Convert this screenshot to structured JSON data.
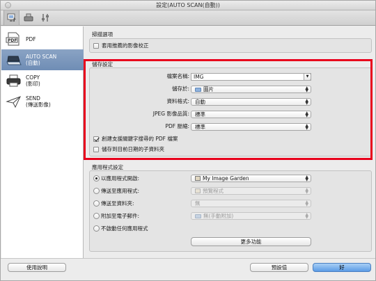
{
  "window": {
    "title": "設定(AUTO SCAN(自動))"
  },
  "toolbar": {
    "tabs": [
      {
        "name": "scan-from-computer-tab",
        "icon": "computer-scan-icon"
      },
      {
        "name": "scan-from-operation-panel-tab",
        "icon": "scanner-icon"
      },
      {
        "name": "general-settings-tab",
        "icon": "sliders-icon"
      }
    ]
  },
  "sidebar": {
    "items": [
      {
        "label": "PDF",
        "sublabel": "",
        "icon": "pdf-document-icon"
      },
      {
        "label": "AUTO SCAN",
        "sublabel": "(自動)",
        "icon": "auto-scan-icon",
        "selected": true
      },
      {
        "label": "COPY",
        "sublabel": "(影印)",
        "icon": "printer-icon"
      },
      {
        "label": "SEND",
        "sublabel": "(傳送影像)",
        "icon": "paper-plane-icon"
      }
    ]
  },
  "scan_options": {
    "title": "掃描選項",
    "apply_correction_label": "套用推薦的影像校正",
    "apply_correction_checked": false
  },
  "save_settings": {
    "title": "儲存設定",
    "file_name_label": "檔案名稱:",
    "file_name_value": "IMG",
    "save_in_label": "儲存於:",
    "save_in_value": "圖片",
    "data_format_label": "資料格式:",
    "data_format_value": "自動",
    "jpeg_quality_label": "JPEG 影像品質:",
    "jpeg_quality_value": "標準",
    "pdf_compression_label": "PDF 壓縮:",
    "pdf_compression_value": "標準",
    "create_pdf_keyword_label": "創建支援關鍵字搜尋的 PDF 檔案",
    "create_pdf_keyword_checked": true,
    "save_subfolder_label": "儲存到目前日期的子資料夾",
    "save_subfolder_checked": false
  },
  "app_settings": {
    "title": "應用程式設定",
    "open_app_label": "以應用程式開啟:",
    "open_app_value": "My Image Garden",
    "send_app_label": "傳送至應用程式:",
    "send_app_value": "預覽程式",
    "send_folder_label": "傳送至資料夾:",
    "send_folder_value": "無",
    "email_label": "附加至電子郵件:",
    "email_value": "無(手動附加)",
    "no_app_label": "不啟動任何應用程式",
    "more_functions_label": "更多功能",
    "selected": "open_app"
  },
  "footer": {
    "help_label": "使用說明",
    "defaults_label": "預設值",
    "ok_label": "好"
  },
  "colors": {
    "highlight": "#e8001c",
    "selected_item": "#7b96bb",
    "default_button": "#5c9ce6"
  }
}
